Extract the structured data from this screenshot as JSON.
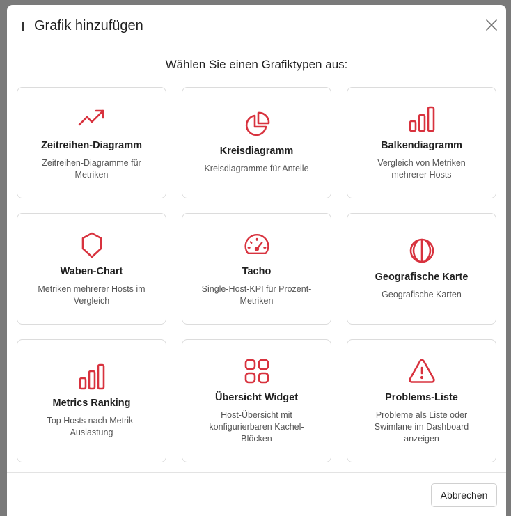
{
  "dialog": {
    "title": "Grafik hinzufügen",
    "subtitle": "Wählen Sie einen Grafiktypen aus:",
    "cancel_label": "Abbrechen",
    "accent_color": "#d8323e"
  },
  "cards": [
    {
      "id": "timeseries",
      "icon": "trending-up-icon",
      "title": "Zeitreihen-Diagramm",
      "desc": "Zeitreihen-Diagramme für Metriken"
    },
    {
      "id": "pie",
      "icon": "pie-chart-icon",
      "title": "Kreisdiagramm",
      "desc": "Kreisdiagramme für Anteile"
    },
    {
      "id": "bar",
      "icon": "bar-chart-icon",
      "title": "Balkendiagramm",
      "desc": "Vergleich von Metriken mehrerer Hosts"
    },
    {
      "id": "honeycomb",
      "icon": "hexagon-icon",
      "title": "Waben-Chart",
      "desc": "Metriken mehrerer Hosts im Vergleich"
    },
    {
      "id": "gauge",
      "icon": "gauge-icon",
      "title": "Tacho",
      "desc": "Single-Host-KPI für Prozent-Metriken"
    },
    {
      "id": "geomap",
      "icon": "globe-icon",
      "title": "Geografische Karte",
      "desc": "Geografische Karten"
    },
    {
      "id": "ranking",
      "icon": "bar-chart-icon",
      "title": "Metrics Ranking",
      "desc": "Top Hosts nach Metrik-Auslastung"
    },
    {
      "id": "overview",
      "icon": "grid-icon",
      "title": "Übersicht Widget",
      "desc": "Host-Übersicht mit konfigurierbaren Kachel-Blöcken"
    },
    {
      "id": "problems",
      "icon": "warning-triangle-icon",
      "title": "Problems-Liste",
      "desc": "Probleme als Liste oder Swimlane im Dashboard anzeigen"
    }
  ]
}
